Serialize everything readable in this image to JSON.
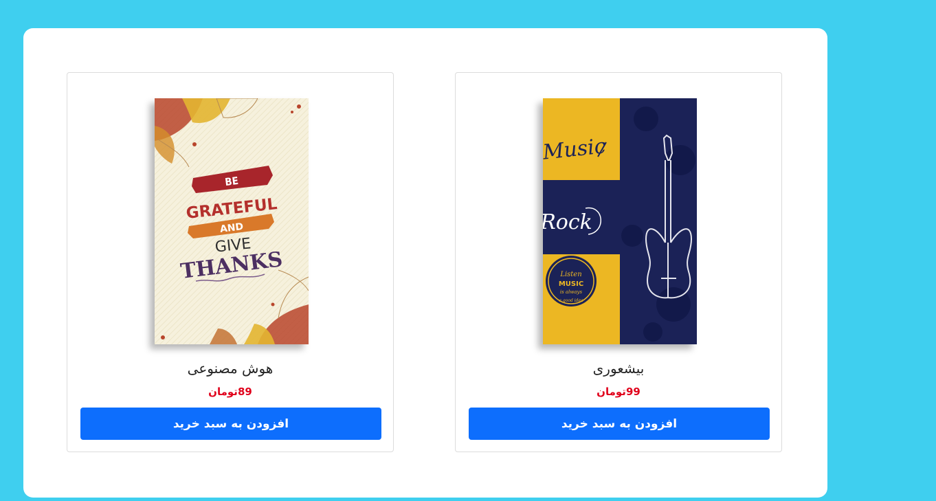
{
  "products": [
    {
      "name": "هوش مصنوعی",
      "price": "89تومان",
      "button_label": "افزودن به سبد خرید",
      "cover": {
        "line1": "BE",
        "line2": "GRATEFUL",
        "line3": "AND",
        "line4": "GIVE",
        "line5": "THANKS"
      }
    },
    {
      "name": "بیشعوری",
      "price": "99تومان",
      "button_label": "افزودن به سبد خرید",
      "cover": {
        "music": "Music",
        "rock": "Rock",
        "badge1": "Listen",
        "badge2": "MUSIC",
        "badge3": "is always",
        "badge4": "a good idea"
      }
    }
  ],
  "colors": {
    "page_background": "#3fcfef",
    "button": "#0d6efd",
    "price": "#e0001b"
  }
}
